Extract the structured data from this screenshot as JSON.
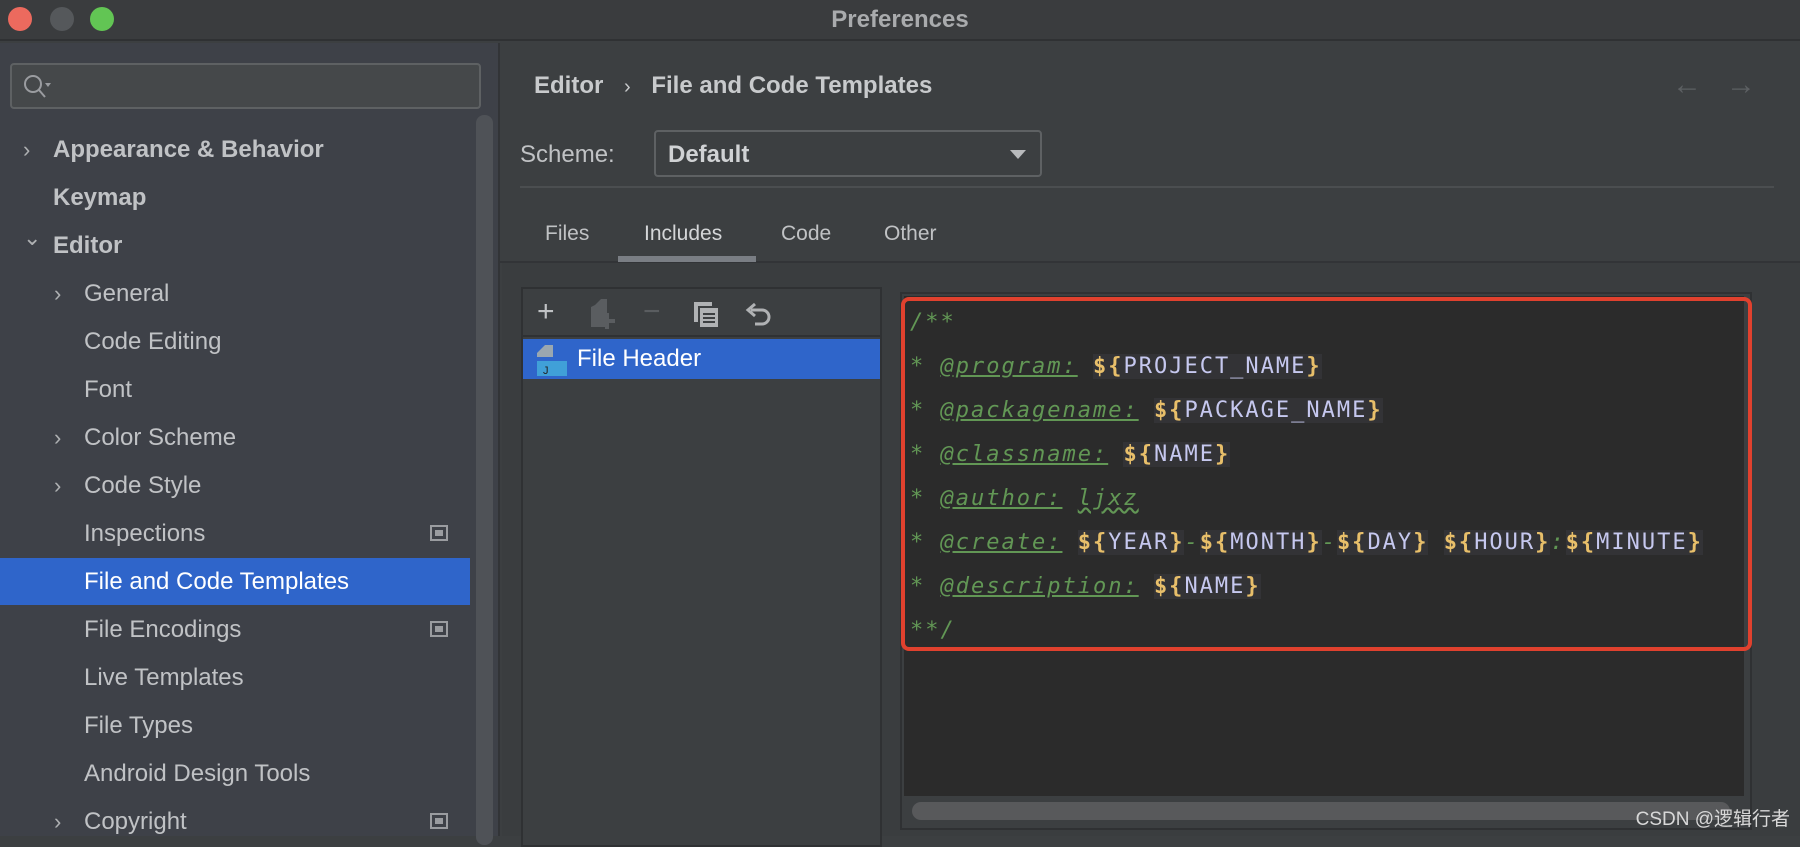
{
  "window": {
    "title": "Preferences",
    "traffic_lights": [
      "#ec6a5e",
      "#55585b",
      "#62c554"
    ]
  },
  "sidebar": {
    "search_placeholder": "",
    "items": [
      {
        "label": "Appearance & Behavior",
        "chevron": "right",
        "indent": 0
      },
      {
        "label": "Keymap",
        "chevron": "",
        "indent": 0
      },
      {
        "label": "Editor",
        "chevron": "down",
        "indent": 0
      },
      {
        "label": "General",
        "chevron": "right",
        "indent": 1
      },
      {
        "label": "Code Editing",
        "chevron": "",
        "indent": 1
      },
      {
        "label": "Font",
        "chevron": "",
        "indent": 1
      },
      {
        "label": "Color Scheme",
        "chevron": "right",
        "indent": 1
      },
      {
        "label": "Code Style",
        "chevron": "right",
        "indent": 1
      },
      {
        "label": "Inspections",
        "chevron": "",
        "indent": 1,
        "badge": true
      },
      {
        "label": "File and Code Templates",
        "chevron": "",
        "indent": 1,
        "selected": true
      },
      {
        "label": "File Encodings",
        "chevron": "",
        "indent": 1,
        "badge": true
      },
      {
        "label": "Live Templates",
        "chevron": "",
        "indent": 1
      },
      {
        "label": "File Types",
        "chevron": "",
        "indent": 1
      },
      {
        "label": "Android Design Tools",
        "chevron": "",
        "indent": 1
      },
      {
        "label": "Copyright",
        "chevron": "right",
        "indent": 1,
        "badge": true
      }
    ]
  },
  "breadcrumb": {
    "parent": "Editor",
    "separator": "›",
    "current": "File and Code Templates"
  },
  "nav": {
    "back": "←",
    "forward": "→"
  },
  "scheme": {
    "label": "Scheme:",
    "value": "Default"
  },
  "tabs": [
    {
      "label": "Files"
    },
    {
      "label": "Includes",
      "active": true
    },
    {
      "label": "Code"
    },
    {
      "label": "Other"
    }
  ],
  "list": {
    "toolbar": [
      "plus-icon",
      "copy-add-icon",
      "minus-icon",
      "duplicate-icon",
      "undo-icon"
    ],
    "items": [
      {
        "label": "File Header",
        "selected": true
      }
    ]
  },
  "code_lines": [
    "/**",
    "* @program: ${PROJECT_NAME}",
    "* @packagename: ${PACKAGE_NAME}",
    "* @classname: ${NAME}",
    "* @author: ljxz",
    "* @create: ${YEAR}-${MONTH}-${DAY} ${HOUR}:${MINUTE}",
    "* @description: ${NAME}",
    "**/"
  ],
  "colors": {
    "selection": "#2f65ca",
    "comment": "#629755",
    "template_var_delim": "#e8bf6a",
    "template_var": "#c6c8ef",
    "highlight": "#e0412e"
  },
  "watermark": "CSDN @逻辑行者"
}
